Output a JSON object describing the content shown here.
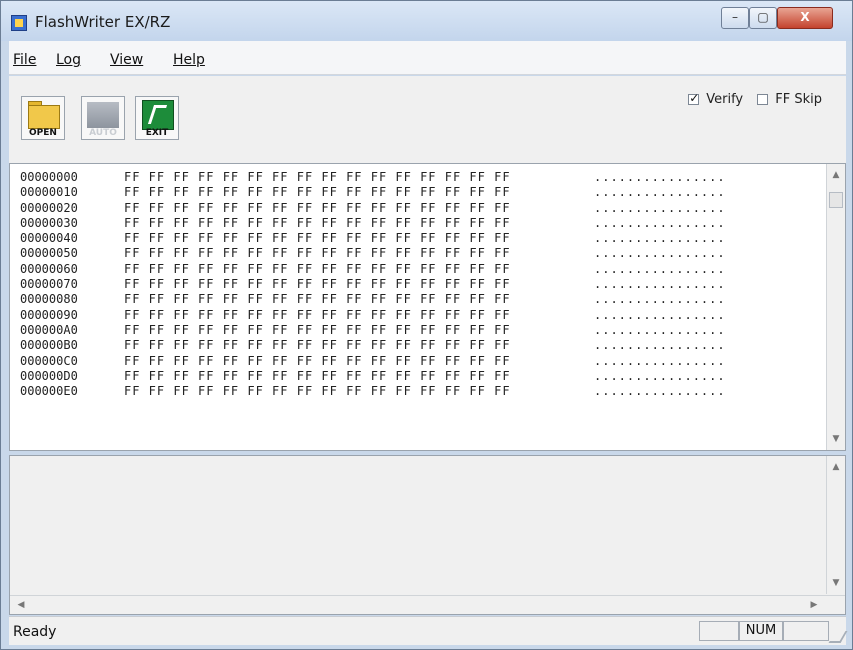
{
  "window": {
    "title": "FlashWriter EX/RZ",
    "close_symbol": "X",
    "min_symbol": "–",
    "max_symbol": "▢"
  },
  "menu": [
    "File",
    "Log",
    "View",
    "Help"
  ],
  "toolbar": {
    "open_label": "OPEN",
    "auto_label": "AUTO",
    "exit_label": "EXIT",
    "verify_label": "Verify",
    "ff_skip_label": "FF Skip",
    "verify_checked": true,
    "ff_skip_checked": false
  },
  "hex": {
    "rows": [
      {
        "addr": "00000000",
        "bytes": "FF FF FF FF FF FF FF FF  FF FF FF FF FF FF FF FF",
        "ascii": "................"
      },
      {
        "addr": "00000010",
        "bytes": "FF FF FF FF FF FF FF FF  FF FF FF FF FF FF FF FF",
        "ascii": "................"
      },
      {
        "addr": "00000020",
        "bytes": "FF FF FF FF FF FF FF FF  FF FF FF FF FF FF FF FF",
        "ascii": "................"
      },
      {
        "addr": "00000030",
        "bytes": "FF FF FF FF FF FF FF FF  FF FF FF FF FF FF FF FF",
        "ascii": "................"
      },
      {
        "addr": "00000040",
        "bytes": "FF FF FF FF FF FF FF FF  FF FF FF FF FF FF FF FF",
        "ascii": "................"
      },
      {
        "addr": "00000050",
        "bytes": "FF FF FF FF FF FF FF FF  FF FF FF FF FF FF FF FF",
        "ascii": "................"
      },
      {
        "addr": "00000060",
        "bytes": "FF FF FF FF FF FF FF FF  FF FF FF FF FF FF FF FF",
        "ascii": "................"
      },
      {
        "addr": "00000070",
        "bytes": "FF FF FF FF FF FF FF FF  FF FF FF FF FF FF FF FF",
        "ascii": "................"
      },
      {
        "addr": "00000080",
        "bytes": "FF FF FF FF FF FF FF FF  FF FF FF FF FF FF FF FF",
        "ascii": "................"
      },
      {
        "addr": "00000090",
        "bytes": "FF FF FF FF FF FF FF FF  FF FF FF FF FF FF FF FF",
        "ascii": "................"
      },
      {
        "addr": "000000A0",
        "bytes": "FF FF FF FF FF FF FF FF  FF FF FF FF FF FF FF FF",
        "ascii": "................"
      },
      {
        "addr": "000000B0",
        "bytes": "FF FF FF FF FF FF FF FF  FF FF FF FF FF FF FF FF",
        "ascii": "................"
      },
      {
        "addr": "000000C0",
        "bytes": "FF FF FF FF FF FF FF FF  FF FF FF FF FF FF FF FF",
        "ascii": "................"
      },
      {
        "addr": "000000D0",
        "bytes": "FF FF FF FF FF FF FF FF  FF FF FF FF FF FF FF FF",
        "ascii": "................"
      },
      {
        "addr": "000000E0",
        "bytes": "FF FF FF FF FF FF FF FF  FF FF FF FF FF FF FF FF",
        "ascii": "................"
      }
    ]
  },
  "status": {
    "text": "Ready",
    "num_label": "NUM"
  }
}
